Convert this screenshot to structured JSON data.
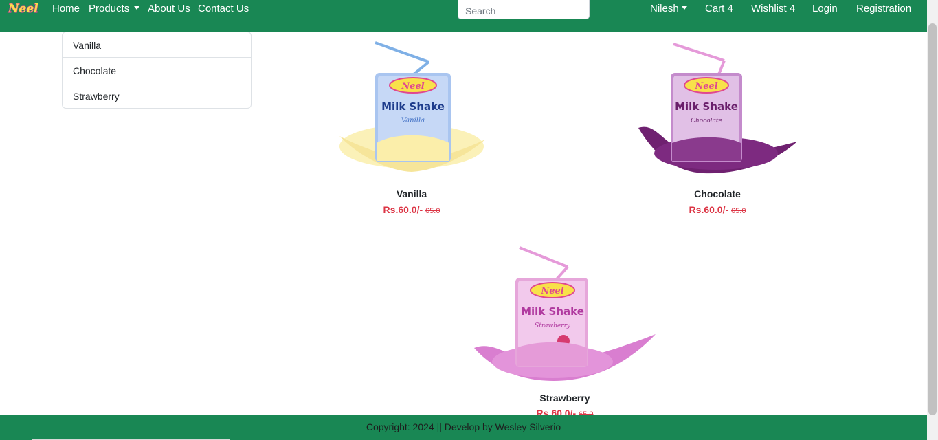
{
  "navbar": {
    "logo_text": "Neel",
    "links": {
      "home": "Home",
      "products": "Products",
      "about": "About Us",
      "contact": "Contact Us"
    },
    "search_placeholder": "Search",
    "user": "Nilesh",
    "cart": "Cart 4",
    "wishlist": "Wishlist 4",
    "login": "Login",
    "registration": "Registration"
  },
  "categories": [
    "Vanilla",
    "Chocolate",
    "Strawberry"
  ],
  "products": [
    {
      "name": "Vanilla",
      "price": "Rs.60.0/-",
      "old_price": "65.0",
      "pack_label": "Milk Shake",
      "flavor_script": "Vanilla",
      "pack_color": "#a9c5f0",
      "splash_color": "#fbf1b8"
    },
    {
      "name": "Chocolate",
      "price": "Rs.60.0/-",
      "old_price": "65.0",
      "pack_label": "Milk Shake",
      "flavor_script": "Chocolate",
      "pack_color": "#d7a8dc",
      "splash_color": "#6f2170"
    },
    {
      "name": "Strawberry",
      "price": "Rs.60.0/-",
      "old_price": "65.0",
      "pack_label": "Milk Shake",
      "flavor_script": "Strawberry",
      "pack_color": "#efb9e3",
      "splash_color": "#d97ed0"
    }
  ],
  "footer": {
    "text": "Copyright: 2024 || Develop by Wesley Silverio"
  },
  "colors": {
    "brand_green": "#198754",
    "price_red": "#dc3545"
  }
}
